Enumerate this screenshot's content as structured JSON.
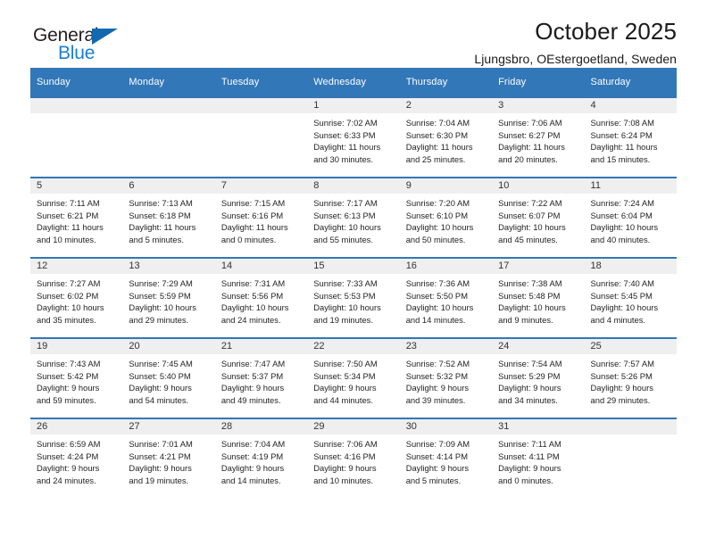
{
  "brand": {
    "name_part1": "General",
    "name_part2": "Blue",
    "triangle_color": "#1269b0",
    "blue_color": "#1a7fd4"
  },
  "header": {
    "title": "October 2025",
    "subtitle": "Ljungsbro, OEstergoetland, Sweden"
  },
  "theme": {
    "header_row_bg": "#3277b8",
    "daynum_band_bg": "#efefef",
    "row_border": "#3277b8"
  },
  "weekdays": [
    "Sunday",
    "Monday",
    "Tuesday",
    "Wednesday",
    "Thursday",
    "Friday",
    "Saturday"
  ],
  "weeks": [
    [
      {
        "day": "",
        "lines": []
      },
      {
        "day": "",
        "lines": []
      },
      {
        "day": "",
        "lines": []
      },
      {
        "day": "1",
        "lines": [
          "Sunrise: 7:02 AM",
          "Sunset: 6:33 PM",
          "Daylight: 11 hours",
          "and 30 minutes."
        ]
      },
      {
        "day": "2",
        "lines": [
          "Sunrise: 7:04 AM",
          "Sunset: 6:30 PM",
          "Daylight: 11 hours",
          "and 25 minutes."
        ]
      },
      {
        "day": "3",
        "lines": [
          "Sunrise: 7:06 AM",
          "Sunset: 6:27 PM",
          "Daylight: 11 hours",
          "and 20 minutes."
        ]
      },
      {
        "day": "4",
        "lines": [
          "Sunrise: 7:08 AM",
          "Sunset: 6:24 PM",
          "Daylight: 11 hours",
          "and 15 minutes."
        ]
      }
    ],
    [
      {
        "day": "5",
        "lines": [
          "Sunrise: 7:11 AM",
          "Sunset: 6:21 PM",
          "Daylight: 11 hours",
          "and 10 minutes."
        ]
      },
      {
        "day": "6",
        "lines": [
          "Sunrise: 7:13 AM",
          "Sunset: 6:18 PM",
          "Daylight: 11 hours",
          "and 5 minutes."
        ]
      },
      {
        "day": "7",
        "lines": [
          "Sunrise: 7:15 AM",
          "Sunset: 6:16 PM",
          "Daylight: 11 hours",
          "and 0 minutes."
        ]
      },
      {
        "day": "8",
        "lines": [
          "Sunrise: 7:17 AM",
          "Sunset: 6:13 PM",
          "Daylight: 10 hours",
          "and 55 minutes."
        ]
      },
      {
        "day": "9",
        "lines": [
          "Sunrise: 7:20 AM",
          "Sunset: 6:10 PM",
          "Daylight: 10 hours",
          "and 50 minutes."
        ]
      },
      {
        "day": "10",
        "lines": [
          "Sunrise: 7:22 AM",
          "Sunset: 6:07 PM",
          "Daylight: 10 hours",
          "and 45 minutes."
        ]
      },
      {
        "day": "11",
        "lines": [
          "Sunrise: 7:24 AM",
          "Sunset: 6:04 PM",
          "Daylight: 10 hours",
          "and 40 minutes."
        ]
      }
    ],
    [
      {
        "day": "12",
        "lines": [
          "Sunrise: 7:27 AM",
          "Sunset: 6:02 PM",
          "Daylight: 10 hours",
          "and 35 minutes."
        ]
      },
      {
        "day": "13",
        "lines": [
          "Sunrise: 7:29 AM",
          "Sunset: 5:59 PM",
          "Daylight: 10 hours",
          "and 29 minutes."
        ]
      },
      {
        "day": "14",
        "lines": [
          "Sunrise: 7:31 AM",
          "Sunset: 5:56 PM",
          "Daylight: 10 hours",
          "and 24 minutes."
        ]
      },
      {
        "day": "15",
        "lines": [
          "Sunrise: 7:33 AM",
          "Sunset: 5:53 PM",
          "Daylight: 10 hours",
          "and 19 minutes."
        ]
      },
      {
        "day": "16",
        "lines": [
          "Sunrise: 7:36 AM",
          "Sunset: 5:50 PM",
          "Daylight: 10 hours",
          "and 14 minutes."
        ]
      },
      {
        "day": "17",
        "lines": [
          "Sunrise: 7:38 AM",
          "Sunset: 5:48 PM",
          "Daylight: 10 hours",
          "and 9 minutes."
        ]
      },
      {
        "day": "18",
        "lines": [
          "Sunrise: 7:40 AM",
          "Sunset: 5:45 PM",
          "Daylight: 10 hours",
          "and 4 minutes."
        ]
      }
    ],
    [
      {
        "day": "19",
        "lines": [
          "Sunrise: 7:43 AM",
          "Sunset: 5:42 PM",
          "Daylight: 9 hours",
          "and 59 minutes."
        ]
      },
      {
        "day": "20",
        "lines": [
          "Sunrise: 7:45 AM",
          "Sunset: 5:40 PM",
          "Daylight: 9 hours",
          "and 54 minutes."
        ]
      },
      {
        "day": "21",
        "lines": [
          "Sunrise: 7:47 AM",
          "Sunset: 5:37 PM",
          "Daylight: 9 hours",
          "and 49 minutes."
        ]
      },
      {
        "day": "22",
        "lines": [
          "Sunrise: 7:50 AM",
          "Sunset: 5:34 PM",
          "Daylight: 9 hours",
          "and 44 minutes."
        ]
      },
      {
        "day": "23",
        "lines": [
          "Sunrise: 7:52 AM",
          "Sunset: 5:32 PM",
          "Daylight: 9 hours",
          "and 39 minutes."
        ]
      },
      {
        "day": "24",
        "lines": [
          "Sunrise: 7:54 AM",
          "Sunset: 5:29 PM",
          "Daylight: 9 hours",
          "and 34 minutes."
        ]
      },
      {
        "day": "25",
        "lines": [
          "Sunrise: 7:57 AM",
          "Sunset: 5:26 PM",
          "Daylight: 9 hours",
          "and 29 minutes."
        ]
      }
    ],
    [
      {
        "day": "26",
        "lines": [
          "Sunrise: 6:59 AM",
          "Sunset: 4:24 PM",
          "Daylight: 9 hours",
          "and 24 minutes."
        ]
      },
      {
        "day": "27",
        "lines": [
          "Sunrise: 7:01 AM",
          "Sunset: 4:21 PM",
          "Daylight: 9 hours",
          "and 19 minutes."
        ]
      },
      {
        "day": "28",
        "lines": [
          "Sunrise: 7:04 AM",
          "Sunset: 4:19 PM",
          "Daylight: 9 hours",
          "and 14 minutes."
        ]
      },
      {
        "day": "29",
        "lines": [
          "Sunrise: 7:06 AM",
          "Sunset: 4:16 PM",
          "Daylight: 9 hours",
          "and 10 minutes."
        ]
      },
      {
        "day": "30",
        "lines": [
          "Sunrise: 7:09 AM",
          "Sunset: 4:14 PM",
          "Daylight: 9 hours",
          "and 5 minutes."
        ]
      },
      {
        "day": "31",
        "lines": [
          "Sunrise: 7:11 AM",
          "Sunset: 4:11 PM",
          "Daylight: 9 hours",
          "and 0 minutes."
        ]
      },
      {
        "day": "",
        "lines": []
      }
    ]
  ]
}
